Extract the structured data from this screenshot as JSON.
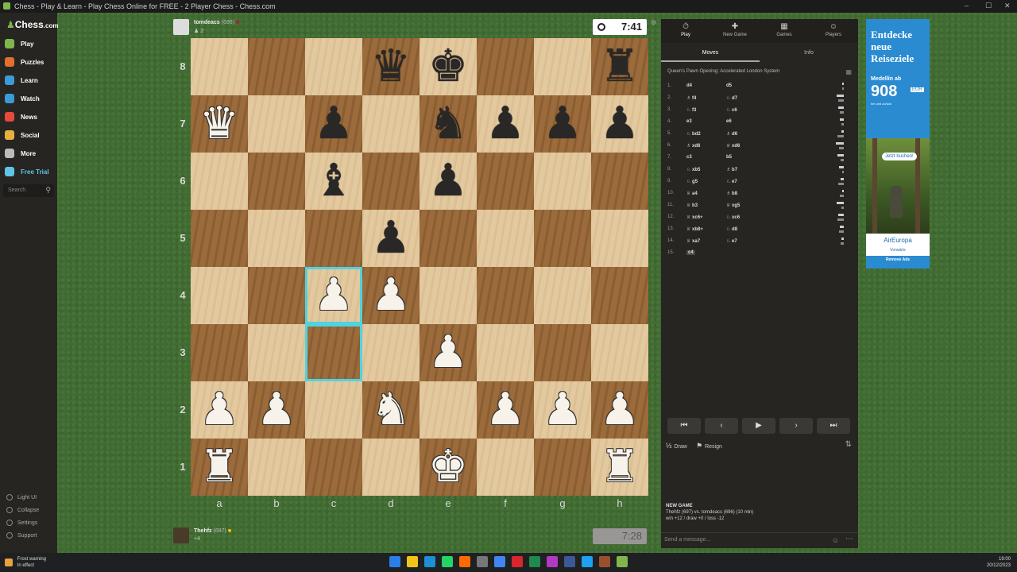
{
  "window": {
    "title": "Chess - Play & Learn - Play Chess Online for FREE - 2 Player Chess - Chess.com",
    "controls": [
      "–",
      "☐",
      "✕"
    ]
  },
  "sidebar": {
    "logo": "Chess",
    "logo_suffix": ".com",
    "items": [
      {
        "label": "Play",
        "icon": "play-icon",
        "color": "#81b64c"
      },
      {
        "label": "Puzzles",
        "icon": "puzzle-icon",
        "color": "#e46f2c"
      },
      {
        "label": "Learn",
        "icon": "learn-icon",
        "color": "#3b9bd8"
      },
      {
        "label": "Watch",
        "icon": "watch-icon",
        "color": "#3b9bd8"
      },
      {
        "label": "News",
        "icon": "news-icon",
        "color": "#e64a3c"
      },
      {
        "label": "Social",
        "icon": "social-icon",
        "color": "#e6b23c"
      },
      {
        "label": "More",
        "icon": "more-icon",
        "color": "#bbbbbb"
      },
      {
        "label": "Free Trial",
        "icon": "diamond-icon",
        "color": "#5fc4e6"
      }
    ],
    "search_placeholder": "Search",
    "footer": [
      "Light UI",
      "Collapse",
      "Settings",
      "Support"
    ]
  },
  "top_player": {
    "name": "tomdeacs",
    "rating": "(696)",
    "clock": "7:41",
    "sub": "♟ 2"
  },
  "bottom_player": {
    "name": "Thehfz",
    "rating": "(697)",
    "clock": "7:28",
    "sub": "+4"
  },
  "board": {
    "ranks": [
      "8",
      "7",
      "6",
      "5",
      "4",
      "3",
      "2",
      "1"
    ],
    "files": [
      "a",
      "b",
      "c",
      "d",
      "e",
      "f",
      "g",
      "h"
    ],
    "pieces": [
      {
        "square": "d8",
        "glyph": "♛",
        "color": "b"
      },
      {
        "square": "e8",
        "glyph": "♚",
        "color": "b"
      },
      {
        "square": "h8",
        "glyph": "♜",
        "color": "b"
      },
      {
        "square": "a7",
        "glyph": "♛",
        "color": "w"
      },
      {
        "square": "c7",
        "glyph": "♟",
        "color": "b"
      },
      {
        "square": "e7",
        "glyph": "♞",
        "color": "b"
      },
      {
        "square": "f7",
        "glyph": "♟",
        "color": "b"
      },
      {
        "square": "g7",
        "glyph": "♟",
        "color": "b"
      },
      {
        "square": "h7",
        "glyph": "♟",
        "color": "b"
      },
      {
        "square": "c6",
        "glyph": "♝",
        "color": "b"
      },
      {
        "square": "e6",
        "glyph": "♟",
        "color": "b"
      },
      {
        "square": "d5",
        "glyph": "♟",
        "color": "b"
      },
      {
        "square": "c4",
        "glyph": "♟",
        "color": "w"
      },
      {
        "square": "d4",
        "glyph": "♟",
        "color": "w"
      },
      {
        "square": "e3",
        "glyph": "♟",
        "color": "w"
      },
      {
        "square": "a2",
        "glyph": "♟",
        "color": "w"
      },
      {
        "square": "b2",
        "glyph": "♟",
        "color": "w"
      },
      {
        "square": "d2",
        "glyph": "♞",
        "color": "w"
      },
      {
        "square": "f2",
        "glyph": "♟",
        "color": "w"
      },
      {
        "square": "g2",
        "glyph": "♟",
        "color": "w"
      },
      {
        "square": "h2",
        "glyph": "♟",
        "color": "w"
      },
      {
        "square": "a1",
        "glyph": "♜",
        "color": "w"
      },
      {
        "square": "e1",
        "glyph": "♚",
        "color": "w"
      },
      {
        "square": "h1",
        "glyph": "♜",
        "color": "w"
      }
    ],
    "highlighted": [
      "c4",
      "c3"
    ],
    "highlight_color": "#4fd3e0"
  },
  "panel": {
    "tabs": [
      {
        "label": "Play",
        "icon": "⏱"
      },
      {
        "label": "New Game",
        "icon": "✚"
      },
      {
        "label": "Games",
        "icon": "▦"
      },
      {
        "label": "Players",
        "icon": "☺"
      }
    ],
    "subtabs": [
      "Moves",
      "Info"
    ],
    "opening": "Queen's Pawn Opening: Accelerated London System",
    "moves": [
      {
        "n": "1.",
        "w": "d4",
        "b": "d5"
      },
      {
        "n": "2.",
        "w": "♗ f4",
        "b": "♘ d7"
      },
      {
        "n": "3.",
        "w": "♘ f3",
        "b": "♘ c6"
      },
      {
        "n": "4.",
        "w": "e3",
        "b": "e6"
      },
      {
        "n": "5.",
        "w": "♘ bd2",
        "b": "♗ d6"
      },
      {
        "n": "6.",
        "w": "♗ xd6",
        "b": "♕ xd6"
      },
      {
        "n": "7.",
        "w": "c3",
        "b": "b5"
      },
      {
        "n": "8.",
        "w": "♘ xb5",
        "b": "♗ b7"
      },
      {
        "n": "9.",
        "w": "♘ g5",
        "b": "♘ e7"
      },
      {
        "n": "10.",
        "w": "♕ a4",
        "b": "♗ b8"
      },
      {
        "n": "11.",
        "w": "♕ b3",
        "b": "♕ xg5"
      },
      {
        "n": "12.",
        "w": "♕ xc6+",
        "b": "♘ xc6"
      },
      {
        "n": "13.",
        "w": "♕ xb8+",
        "b": "♘ d8"
      },
      {
        "n": "14.",
        "w": "♕ xa7",
        "b": "♘ e7"
      },
      {
        "n": "15.",
        "w": "c4",
        "b": ""
      }
    ],
    "controls": [
      "⏮",
      "‹",
      "▶",
      "›",
      "⏭"
    ],
    "draw": "Draw",
    "resign": "Resign",
    "new_game_header": "NEW GAME",
    "new_game_line1": "Thehfz (697) vs. tomdeacs (696) (10 min)",
    "new_game_line2": "win +12 / draw +0 / loss -12",
    "chat_placeholder": "Send a message..."
  },
  "ad": {
    "headline": "Entdecke neue Reiseziele",
    "city": "Medellín ab",
    "price": "908",
    "currency": "EUR",
    "roundtrip": "hin und zurück",
    "cta": "Jetzt buchen!",
    "brand": "AirEuropa",
    "brand_sub": "Vorwärts",
    "remove": "Remove Ads"
  },
  "taskbar": {
    "warning_title": "Frost warning",
    "warning_sub": "In effect",
    "time": "19:00",
    "date": "20/12/2023",
    "apps": [
      "#2b7de9",
      "#f0c419",
      "#1e8fd6",
      "#25d366",
      "#ff6a00",
      "#777777",
      "#4285f4",
      "#d8262c",
      "#1e8a4c",
      "#b03ac2",
      "#3b5998",
      "#1da1f2",
      "#9c4f2c",
      "#81b64c"
    ]
  }
}
